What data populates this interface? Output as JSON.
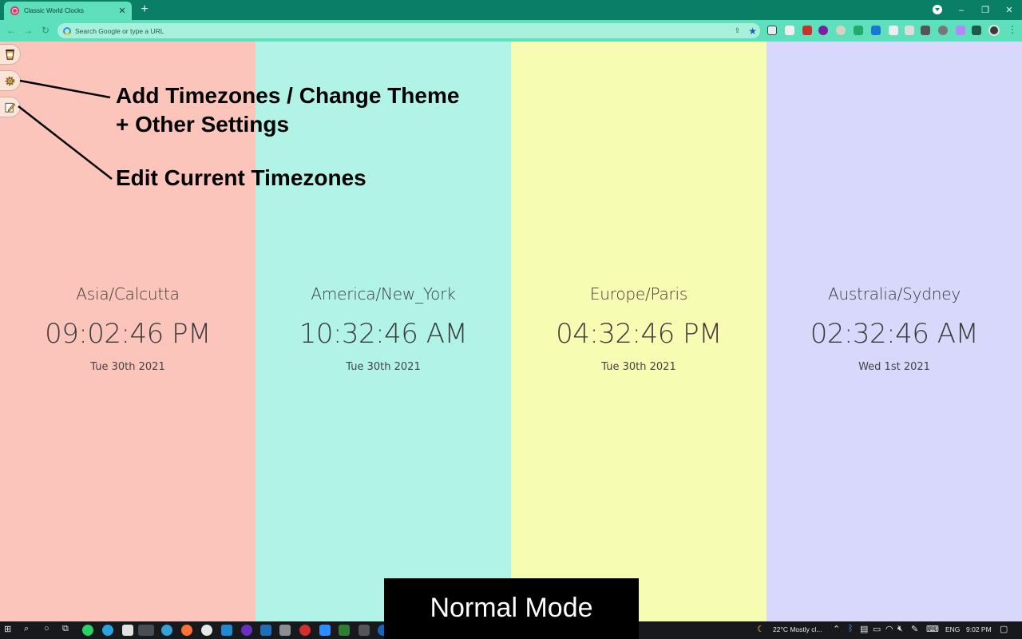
{
  "browser": {
    "tab_title": "Classic World Clocks",
    "tab_close": "✕",
    "new_tab": "+",
    "omnibox_placeholder": "Search Google or type a URL",
    "window_minimize": "–",
    "window_restore": "❐",
    "window_close": "✕"
  },
  "sidebar": {
    "buttons": [
      {
        "name": "donate",
        "icon": "coffee-cup-icon"
      },
      {
        "name": "settings",
        "icon": "gear-icon"
      },
      {
        "name": "edit",
        "icon": "edit-icon"
      }
    ]
  },
  "annotations": {
    "settings_line1": "Add Timezones / Change Theme",
    "settings_line2": "+ Other Settings",
    "edit": "Edit Current Timezones"
  },
  "clocks": [
    {
      "zone": "Asia/Calcutta",
      "time": "09:02:46 PM",
      "date": "Tue 30th 2021",
      "bg": "#fcc5bc"
    },
    {
      "zone": "America/New_York",
      "time": "10:32:46 AM",
      "date": "Tue 30th 2021",
      "bg": "#b1f3e6"
    },
    {
      "zone": "Europe/Paris",
      "time": "04:32:46 PM",
      "date": "Tue 30th 2021",
      "bg": "#f7fcb3"
    },
    {
      "zone": "Australia/Sydney",
      "time": "02:32:46 AM",
      "date": "Wed 1st 2021",
      "bg": "#d7d8fb"
    }
  ],
  "mode_banner": "Normal Mode",
  "taskbar": {
    "weather": "22°C  Mostly cl...",
    "language": "ENG",
    "clock": "9:02 PM"
  },
  "colors": {
    "tabbar": "#0b7f66",
    "toolbar": "#5fe0bd",
    "omnibox": "#a8f0dc"
  }
}
